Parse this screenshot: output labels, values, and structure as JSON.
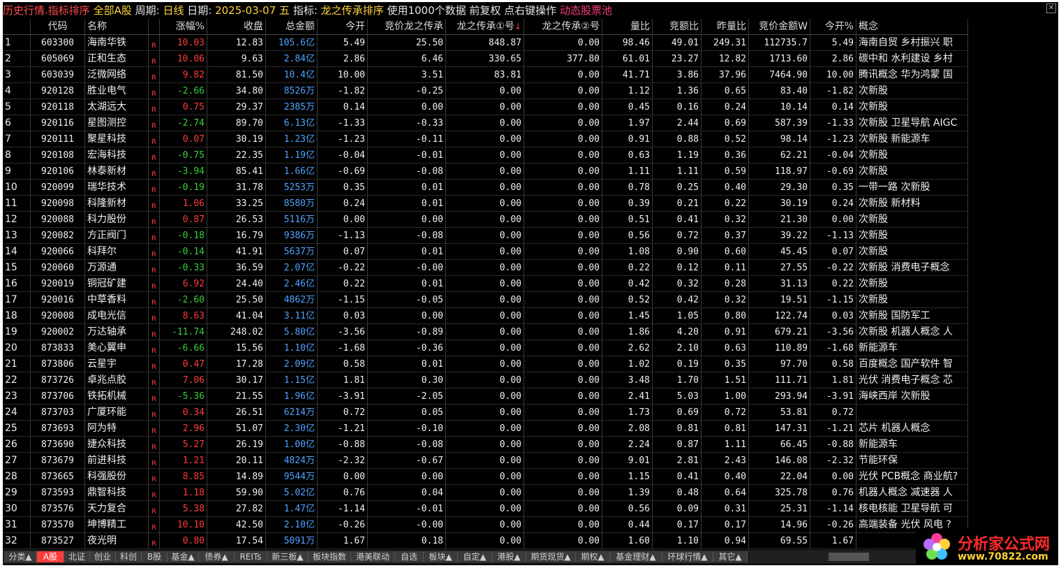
{
  "titlebar": {
    "history": "历史行情.指标排序",
    "market": "全部A股",
    "period_label": "周期:",
    "period_value": "日线",
    "date_label": "日期:",
    "date_value": "2025-03-07 五",
    "indicator_label": "指标:",
    "indicator_value": "龙之传承排序",
    "data_note": "使用1000个数据 前复权 点右键操作",
    "pool": "动态股票池"
  },
  "columns": [
    "代码",
    "名称",
    "涨幅%",
    "收盘",
    "总金额",
    "今开",
    "竞价龙之传承",
    "龙之传承①号",
    "龙之传承②号",
    "量比",
    "竞额比",
    "昨量比",
    "竞价金额W",
    "今开%",
    "概念"
  ],
  "sort_arrow": "↓",
  "rows": [
    {
      "no": "1",
      "code": "603300",
      "name": "海南华铁",
      "chg": "10.03",
      "close": "12.83",
      "amt": "105.6亿",
      "open": "5.49",
      "jj": "25.50",
      "l1": "848.87",
      "l2": "0.00",
      "lb": "98.46",
      "jeb": "49.01",
      "zlb": "249.31",
      "jjje": "112735.7",
      "kp": "5.49",
      "gn": "海南自贸 乡村振兴 职"
    },
    {
      "no": "2",
      "code": "605069",
      "name": "正和生态",
      "chg": "10.06",
      "close": "9.63",
      "amt": "2.84亿",
      "open": "2.86",
      "jj": "6.46",
      "l1": "330.65",
      "l2": "377.80",
      "lb": "61.01",
      "jeb": "23.27",
      "zlb": "12.82",
      "jjje": "1713.60",
      "kp": "2.86",
      "gn": "碳中和 水利建设 乡村"
    },
    {
      "no": "3",
      "code": "603039",
      "name": "泛微网络",
      "chg": "9.82",
      "close": "81.50",
      "amt": "10.4亿",
      "open": "10.00",
      "jj": "3.51",
      "l1": "83.81",
      "l2": "0.00",
      "lb": "41.71",
      "jeb": "3.86",
      "zlb": "37.96",
      "jjje": "7464.90",
      "kp": "10.00",
      "gn": "腾讯概念 华为鸿蒙 国"
    },
    {
      "no": "4",
      "code": "920128",
      "name": "胜业电气",
      "chg": "-2.66",
      "close": "34.80",
      "amt": "8526万",
      "open": "-1.82",
      "jj": "-0.25",
      "l1": "0.00",
      "l2": "0.00",
      "lb": "1.12",
      "jeb": "1.36",
      "zlb": "0.65",
      "jjje": "83.40",
      "kp": "-1.82",
      "gn": "次新股"
    },
    {
      "no": "5",
      "code": "920118",
      "name": "太湖远大",
      "chg": "0.75",
      "close": "29.37",
      "amt": "2385万",
      "open": "0.14",
      "jj": "0.00",
      "l1": "0.00",
      "l2": "0.00",
      "lb": "0.45",
      "jeb": "0.16",
      "zlb": "0.24",
      "jjje": "10.14",
      "kp": "0.14",
      "gn": "次新股"
    },
    {
      "no": "6",
      "code": "920116",
      "name": "星图测控",
      "chg": "-2.74",
      "close": "89.70",
      "amt": "6.13亿",
      "open": "-1.33",
      "jj": "-0.33",
      "l1": "0.00",
      "l2": "0.00",
      "lb": "1.97",
      "jeb": "2.44",
      "zlb": "0.69",
      "jjje": "587.39",
      "kp": "-1.33",
      "gn": "次新股 卫星导航 AIGC"
    },
    {
      "no": "7",
      "code": "920111",
      "name": "聚星科技",
      "chg": "0.07",
      "close": "30.19",
      "amt": "1.23亿",
      "open": "-1.23",
      "jj": "-0.11",
      "l1": "0.00",
      "l2": "0.00",
      "lb": "0.91",
      "jeb": "0.88",
      "zlb": "0.52",
      "jjje": "98.14",
      "kp": "-1.23",
      "gn": "次新股 新能源车"
    },
    {
      "no": "8",
      "code": "920108",
      "name": "宏海科技",
      "chg": "-0.75",
      "close": "22.35",
      "amt": "1.19亿",
      "open": "-0.04",
      "jj": "-0.01",
      "l1": "0.00",
      "l2": "0.00",
      "lb": "0.63",
      "jeb": "1.19",
      "zlb": "0.36",
      "jjje": "62.21",
      "kp": "-0.04",
      "gn": "次新股"
    },
    {
      "no": "9",
      "code": "920106",
      "name": "林泰新材",
      "chg": "-3.94",
      "close": "85.41",
      "amt": "1.66亿",
      "open": "-0.69",
      "jj": "-0.08",
      "l1": "0.00",
      "l2": "0.00",
      "lb": "1.11",
      "jeb": "1.11",
      "zlb": "0.59",
      "jjje": "118.97",
      "kp": "-0.69",
      "gn": "次新股"
    },
    {
      "no": "10",
      "code": "920099",
      "name": "瑞华技术",
      "chg": "-0.19",
      "close": "31.78",
      "amt": "5253万",
      "open": "0.35",
      "jj": "0.01",
      "l1": "0.00",
      "l2": "0.00",
      "lb": "0.78",
      "jeb": "0.25",
      "zlb": "0.40",
      "jjje": "29.30",
      "kp": "0.35",
      "gn": "一带一路 次新股"
    },
    {
      "no": "11",
      "code": "920098",
      "name": "科隆新材",
      "chg": "1.06",
      "close": "33.25",
      "amt": "8580万",
      "open": "0.24",
      "jj": "0.01",
      "l1": "0.00",
      "l2": "0.00",
      "lb": "0.39",
      "jeb": "0.21",
      "zlb": "0.22",
      "jjje": "30.19",
      "kp": "0.24",
      "gn": "次新股 新材料"
    },
    {
      "no": "12",
      "code": "920088",
      "name": "科力股份",
      "chg": "0.87",
      "close": "26.53",
      "amt": "5116万",
      "open": "0.00",
      "jj": "0.00",
      "l1": "0.00",
      "l2": "0.00",
      "lb": "0.51",
      "jeb": "0.41",
      "zlb": "0.32",
      "jjje": "21.30",
      "kp": "0.00",
      "gn": "次新股"
    },
    {
      "no": "13",
      "code": "920082",
      "name": "方正阀门",
      "chg": "-0.18",
      "close": "16.79",
      "amt": "9386万",
      "open": "-1.13",
      "jj": "-0.08",
      "l1": "0.00",
      "l2": "0.00",
      "lb": "0.56",
      "jeb": "0.72",
      "zlb": "0.37",
      "jjje": "39.22",
      "kp": "-1.13",
      "gn": "次新股"
    },
    {
      "no": "14",
      "code": "920066",
      "name": "科拜尔",
      "chg": "-0.14",
      "close": "41.91",
      "amt": "5637万",
      "open": "0.07",
      "jj": "0.01",
      "l1": "0.00",
      "l2": "0.00",
      "lb": "1.08",
      "jeb": "0.90",
      "zlb": "0.60",
      "jjje": "45.45",
      "kp": "0.07",
      "gn": "次新股"
    },
    {
      "no": "15",
      "code": "920060",
      "name": "万源通",
      "chg": "-0.33",
      "close": "36.59",
      "amt": "2.07亿",
      "open": "-0.22",
      "jj": "-0.00",
      "l1": "0.00",
      "l2": "0.00",
      "lb": "0.22",
      "jeb": "0.12",
      "zlb": "0.11",
      "jjje": "27.55",
      "kp": "-0.22",
      "gn": "次新股 消费电子概念"
    },
    {
      "no": "16",
      "code": "920019",
      "name": "铜冠矿建",
      "chg": "6.92",
      "close": "24.40",
      "amt": "2.46亿",
      "open": "0.22",
      "jj": "0.01",
      "l1": "0.00",
      "l2": "0.00",
      "lb": "0.42",
      "jeb": "0.32",
      "zlb": "0.28",
      "jjje": "31.13",
      "kp": "0.22",
      "gn": "次新股"
    },
    {
      "no": "17",
      "code": "920016",
      "name": "中草香料",
      "chg": "-2.60",
      "close": "25.50",
      "amt": "4862万",
      "open": "-1.15",
      "jj": "-0.05",
      "l1": "0.00",
      "l2": "0.00",
      "lb": "0.52",
      "jeb": "0.42",
      "zlb": "0.32",
      "jjje": "19.51",
      "kp": "-1.15",
      "gn": "次新股"
    },
    {
      "no": "18",
      "code": "920008",
      "name": "成电光信",
      "chg": "8.63",
      "close": "41.04",
      "amt": "3.11亿",
      "open": "0.03",
      "jj": "0.00",
      "l1": "0.00",
      "l2": "0.00",
      "lb": "1.45",
      "jeb": "1.05",
      "zlb": "0.80",
      "jjje": "122.74",
      "kp": "0.03",
      "gn": "次新股 国防军工"
    },
    {
      "no": "19",
      "code": "920002",
      "name": "万达轴承",
      "chg": "-11.74",
      "close": "248.02",
      "amt": "5.80亿",
      "open": "-3.56",
      "jj": "-0.89",
      "l1": "0.00",
      "l2": "0.00",
      "lb": "1.86",
      "jeb": "4.20",
      "zlb": "0.91",
      "jjje": "679.21",
      "kp": "-3.56",
      "gn": "次新股 机器人概念 人"
    },
    {
      "no": "20",
      "code": "873833",
      "name": "美心翼申",
      "chg": "-6.66",
      "close": "15.56",
      "amt": "1.10亿",
      "open": "-1.68",
      "jj": "-0.36",
      "l1": "0.00",
      "l2": "0.00",
      "lb": "2.62",
      "jeb": "2.10",
      "zlb": "0.63",
      "jjje": "110.89",
      "kp": "-1.68",
      "gn": "新能源车"
    },
    {
      "no": "21",
      "code": "873806",
      "name": "云星宇",
      "chg": "0.47",
      "close": "17.28",
      "amt": "2.09亿",
      "open": "0.58",
      "jj": "0.01",
      "l1": "0.00",
      "l2": "0.00",
      "lb": "1.02",
      "jeb": "0.19",
      "zlb": "0.35",
      "jjje": "97.70",
      "kp": "0.58",
      "gn": "百度概念 国产软件 智"
    },
    {
      "no": "22",
      "code": "873726",
      "name": "卓兆点胶",
      "chg": "7.06",
      "close": "30.17",
      "amt": "1.15亿",
      "open": "1.81",
      "jj": "0.30",
      "l1": "0.00",
      "l2": "0.00",
      "lb": "3.48",
      "jeb": "1.70",
      "zlb": "1.51",
      "jjje": "111.71",
      "kp": "1.81",
      "gn": "光伏 消费电子概念 芯"
    },
    {
      "no": "23",
      "code": "873706",
      "name": "铁拓机械",
      "chg": "-5.36",
      "close": "21.55",
      "amt": "1.96亿",
      "open": "-3.91",
      "jj": "-2.05",
      "l1": "0.00",
      "l2": "0.00",
      "lb": "2.41",
      "jeb": "5.03",
      "zlb": "1.00",
      "jjje": "293.94",
      "kp": "-3.91",
      "gn": "海峡西岸 次新股"
    },
    {
      "no": "24",
      "code": "873703",
      "name": "广厦环能",
      "chg": "0.34",
      "close": "26.51",
      "amt": "6214万",
      "open": "0.72",
      "jj": "0.05",
      "l1": "0.00",
      "l2": "0.00",
      "lb": "1.73",
      "jeb": "0.69",
      "zlb": "0.72",
      "jjje": "53.81",
      "kp": "0.72",
      "gn": ""
    },
    {
      "no": "25",
      "code": "873693",
      "name": "阿为特",
      "chg": "2.96",
      "close": "51.07",
      "amt": "2.30亿",
      "open": "-1.21",
      "jj": "-0.10",
      "l1": "0.00",
      "l2": "0.00",
      "lb": "2.08",
      "jeb": "0.81",
      "zlb": "0.81",
      "jjje": "147.31",
      "kp": "-1.21",
      "gn": "芯片 机器人概念"
    },
    {
      "no": "26",
      "code": "873690",
      "name": "捷众科技",
      "chg": "5.27",
      "close": "26.19",
      "amt": "1.00亿",
      "open": "-0.88",
      "jj": "-0.08",
      "l1": "0.00",
      "l2": "0.00",
      "lb": "2.24",
      "jeb": "0.87",
      "zlb": "1.11",
      "jjje": "66.45",
      "kp": "-0.88",
      "gn": "新能源车"
    },
    {
      "no": "27",
      "code": "873679",
      "name": "前进科技",
      "chg": "1.21",
      "close": "20.11",
      "amt": "4824万",
      "open": "-2.32",
      "jj": "-0.67",
      "l1": "0.00",
      "l2": "0.00",
      "lb": "9.01",
      "jeb": "2.81",
      "zlb": "2.43",
      "jjje": "146.08",
      "kp": "-2.32",
      "gn": "节能环保"
    },
    {
      "no": "28",
      "code": "873665",
      "name": "科强股份",
      "chg": "8.85",
      "close": "14.89",
      "amt": "9544万",
      "open": "0.00",
      "jj": "0.00",
      "l1": "0.00",
      "l2": "0.00",
      "lb": "1.15",
      "jeb": "0.41",
      "zlb": "0.40",
      "jjje": "22.04",
      "kp": "0.00",
      "gn": "光伏 PCB概念 商业航?"
    },
    {
      "no": "29",
      "code": "873593",
      "name": "鼎智科技",
      "chg": "1.18",
      "close": "59.90",
      "amt": "5.02亿",
      "open": "0.76",
      "jj": "0.04",
      "l1": "0.00",
      "l2": "0.00",
      "lb": "1.39",
      "jeb": "0.48",
      "zlb": "0.64",
      "jjje": "325.78",
      "kp": "0.76",
      "gn": "机器人概念 减速器 人"
    },
    {
      "no": "30",
      "code": "873576",
      "name": "天力复合",
      "chg": "5.38",
      "close": "27.82",
      "amt": "1.47亿",
      "open": "-1.14",
      "jj": "-0.01",
      "l1": "0.00",
      "l2": "0.00",
      "lb": "0.56",
      "jeb": "0.09",
      "zlb": "0.31",
      "jjje": "25.31",
      "kp": "-1.14",
      "gn": "核电核能 卫星导航 可"
    },
    {
      "no": "31",
      "code": "873570",
      "name": "坤博精工",
      "chg": "10.10",
      "close": "42.50",
      "amt": "2.10亿",
      "open": "-0.26",
      "jj": "-0.00",
      "l1": "0.00",
      "l2": "0.00",
      "lb": "0.44",
      "jeb": "0.17",
      "zlb": "0.17",
      "jjje": "14.96",
      "kp": "-0.26",
      "gn": "高端装备 光伏 风电 ?"
    },
    {
      "no": "32",
      "code": "873527",
      "name": "夜光明",
      "chg": "0.80",
      "close": "17.54",
      "amt": "5091万",
      "open": "1.67",
      "jj": "0.18",
      "l1": "0.00",
      "l2": "0.00",
      "lb": "1.60",
      "jeb": "1.10",
      "zlb": "0.94",
      "jjje": "69.55",
      "kp": "1.67",
      "gn": ""
    }
  ],
  "r_mark": "R",
  "tabs": [
    "分类▲",
    "A股",
    "北证",
    "创业",
    "科创",
    "B股",
    "基金▲",
    "债券▲",
    "REITs",
    "新三板▲",
    "板块指数",
    "港美联动",
    "自选",
    "板块▲",
    "自定▲",
    "港股▲",
    "期货现货▲",
    "期权▲",
    "基金理财▲",
    "环球行情▲",
    "其它▲"
  ],
  "watermark": {
    "title": "分析家公式网",
    "url": "www.70822.com"
  },
  "colors": {
    "up": "#ff3c3c",
    "down": "#36d13a",
    "amount": "#4fa3ff",
    "active_tab": "#ff3c3c"
  }
}
